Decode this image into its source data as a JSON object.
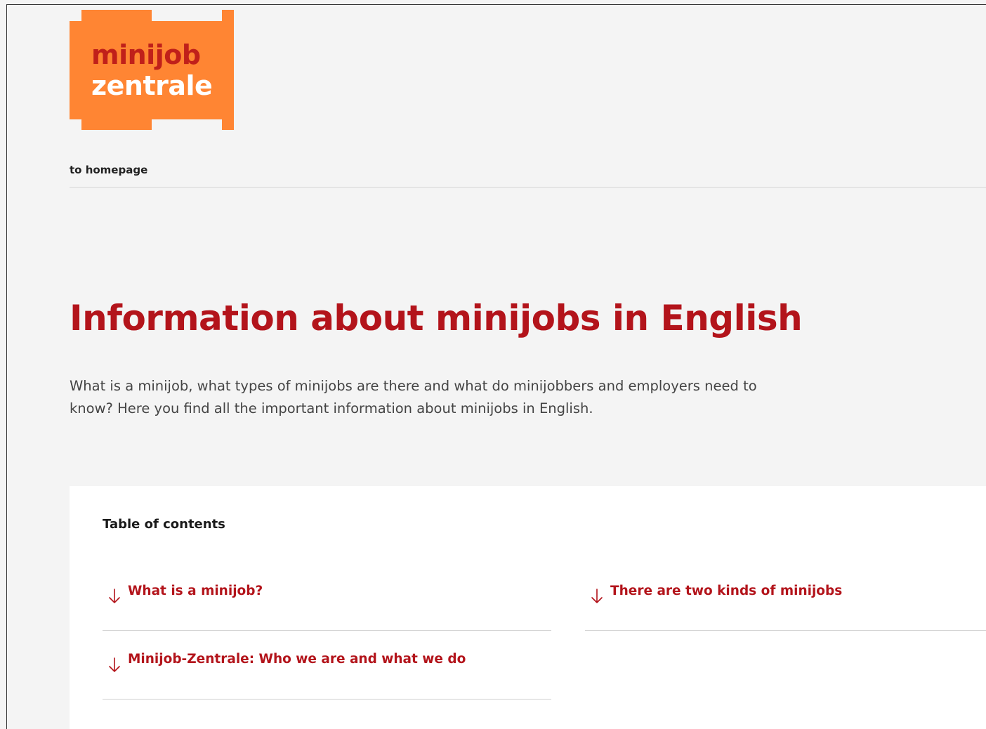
{
  "header": {
    "logo_line1": "minijob",
    "logo_line2": "zentrale",
    "home_link": "to homepage"
  },
  "main": {
    "title": "Information about minijobs in English",
    "intro": "What is a minijob, what types of minijobs are there and what do minijobbers and employers need to know? Here you find all the important information about minijobs in English."
  },
  "toc": {
    "heading": "Table of contents",
    "items": [
      {
        "label": "What is a minijob?",
        "icon": "arrow-down-icon"
      },
      {
        "label": "There are two kinds of minijobs",
        "icon": "arrow-down-icon"
      },
      {
        "label": "Minijob-Zentrale: Who we are and what we do",
        "icon": "arrow-down-icon"
      }
    ]
  },
  "colors": {
    "brand_orange": "#ff8533",
    "brand_red": "#b3141b",
    "background": "#f4f4f4"
  }
}
